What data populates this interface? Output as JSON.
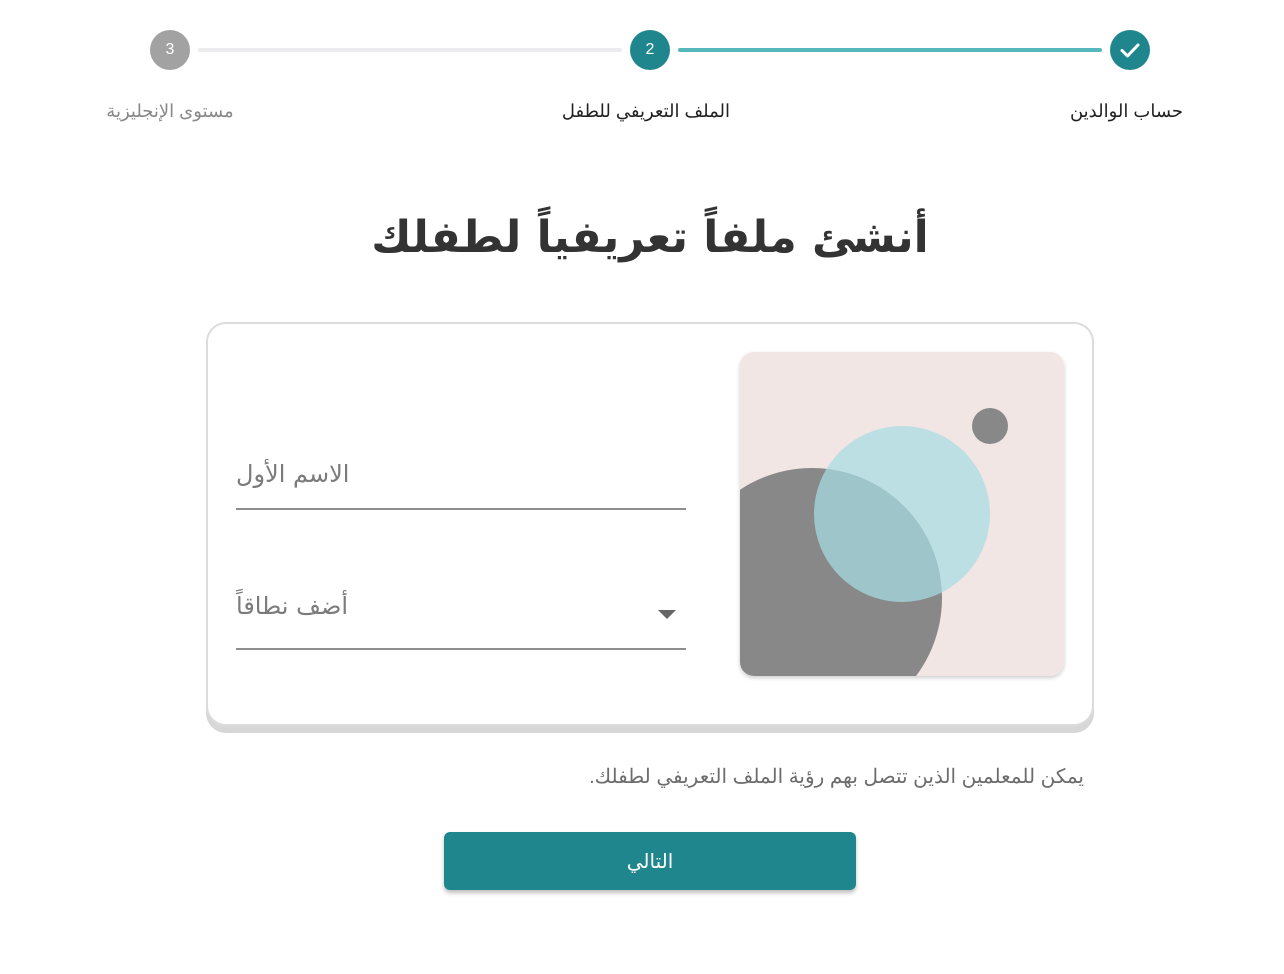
{
  "stepper": {
    "steps": [
      {
        "label": "حساب الوالدين",
        "state": "completed",
        "icon": "check-icon"
      },
      {
        "label": "الملف التعريفي للطفل",
        "number": "2",
        "state": "active"
      },
      {
        "label": "مستوى الإنجليزية",
        "number": "3",
        "state": "pending"
      }
    ]
  },
  "main": {
    "title": "أنشئ ملفاً تعريفياً لطفلك",
    "form": {
      "first_name_placeholder": "الاسم الأول",
      "range_placeholder": "أضف نطاقاً",
      "dropdown_icon": "caret-down-icon"
    },
    "helper_text": "يمكن للمعلمين الذين تتصل بهم رؤية الملف التعريفي لطفلك.",
    "next_button": "التالي"
  },
  "colors": {
    "accent": "#1f868d",
    "progress": "#56b8bd",
    "pending": "#a2a2a2",
    "illustration_bg": "#f2e6e4",
    "illustration_gray": "#888888",
    "illustration_cyan": "#a6dde2"
  }
}
